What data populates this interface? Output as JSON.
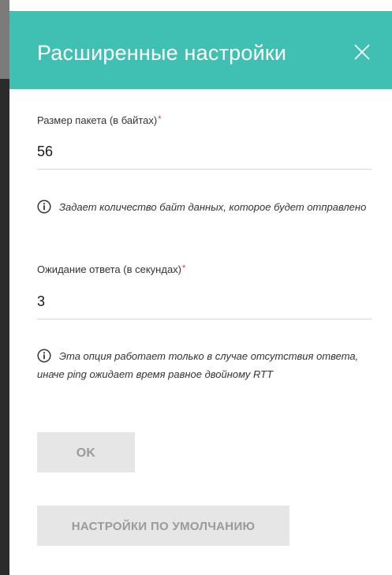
{
  "dialog": {
    "title": "Расширенные настройки",
    "close_icon": "close-icon"
  },
  "fields": [
    {
      "label": "Размер пакета (в байтах)",
      "required_mark": "*",
      "value": "56",
      "hint": "Задает количество байт данных, которое будет отправлено"
    },
    {
      "label": "Ожидание ответа (в секундах)",
      "required_mark": "*",
      "value": "3",
      "hint": "Эта опция работает только в случае отсутствия ответа, иначе ping ожидает время равное двойному RTT"
    }
  ],
  "buttons": {
    "ok_label": "OK",
    "defaults_label": "НАСТРОЙКИ ПО УМОЛЧАНИЮ"
  },
  "colors": {
    "header": "#40bfb3",
    "required": "#e0322b",
    "button_bg": "#e6e6e6",
    "button_text": "#9a9a9a"
  }
}
